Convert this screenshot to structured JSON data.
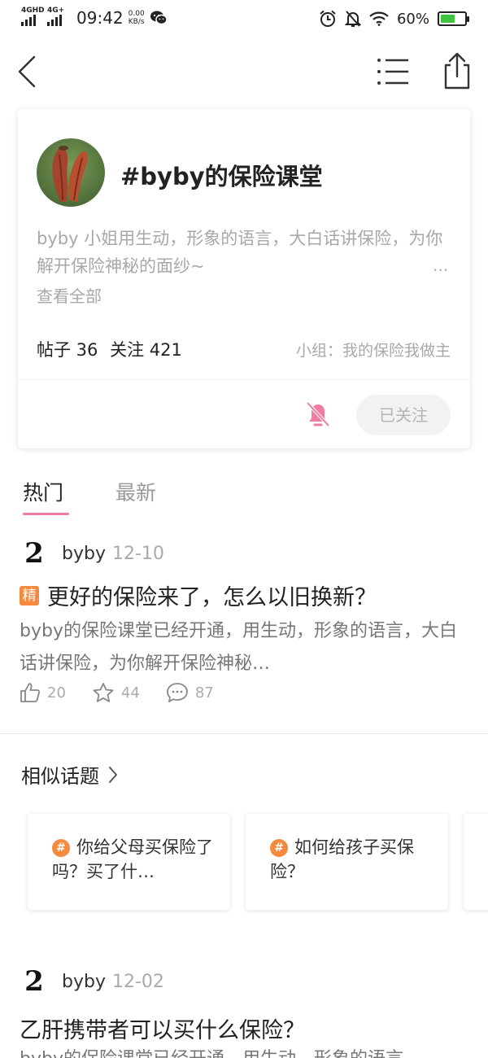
{
  "status_bar": {
    "signal1_label": "4GHD",
    "signal2_label": "4G+",
    "time": "09:42",
    "speed_value": "0.00",
    "speed_unit": "KB/s",
    "battery_percent": "60%",
    "battery_level": 0.6,
    "battery_color": "#3ec43e",
    "icons": [
      "wechat-icon",
      "alarm-icon",
      "mute-bell-icon",
      "wifi-icon",
      "battery-icon"
    ]
  },
  "nav": {
    "icons": [
      "back-arrow-icon",
      "list-icon",
      "share-icon"
    ]
  },
  "topic": {
    "title": "#byby的保险课堂",
    "description": "byby 小姐用生动，形象的语言，大白话讲保险，为你解开保险神秘的面纱~",
    "more": "···",
    "see_all": "查看全部",
    "posts_label": "帖子 36",
    "followers_label": "关注 421",
    "group": "小组：我的保险我做主",
    "follow_button": "已关注",
    "accent_color": "#f07ca0"
  },
  "tabs": {
    "hot": "热门",
    "latest": "最新",
    "active": "hot"
  },
  "posts": [
    {
      "avatar_char": "2",
      "user": "byby",
      "date": "12-10",
      "badge": "精",
      "title": "更好的保险来了，怎么以旧换新？",
      "excerpt": "byby的保险课堂已经开通，用生动，形象的语言，大白话讲保险，为你解开保险神秘…",
      "likes": "20",
      "stars": "44",
      "comments": "87"
    },
    {
      "avatar_char": "2",
      "user": "byby",
      "date": "12-02",
      "title": "乙肝携带者可以买什么保险？",
      "excerpt": "byby的保险课堂已经开通，用生动，形象的语言"
    }
  ],
  "similar": {
    "title": "相似话题",
    "items": [
      {
        "hash": "#",
        "text": "你给父母买保险了吗？买了什…"
      },
      {
        "hash": "#",
        "text": "如何给孩子买保险？"
      }
    ]
  }
}
